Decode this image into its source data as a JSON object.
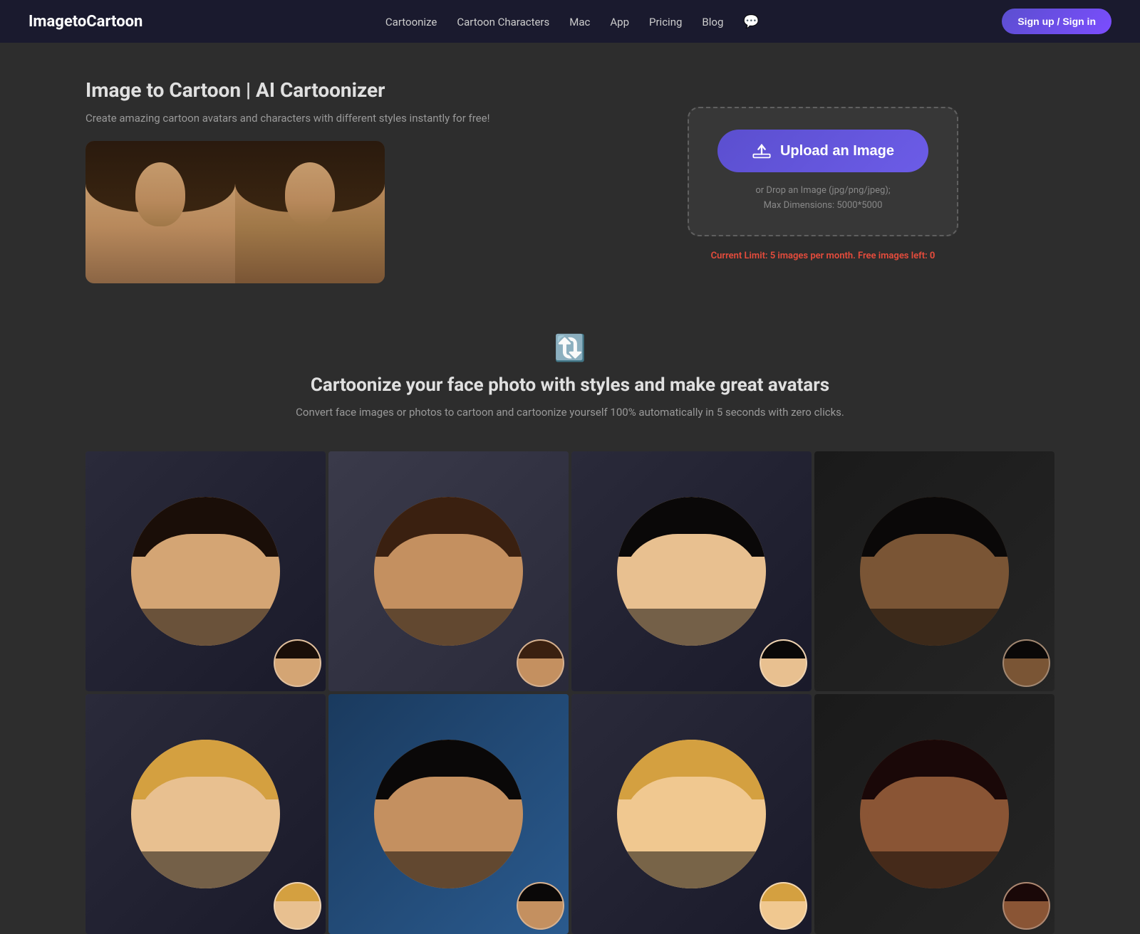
{
  "nav": {
    "logo": "ImagetoCartoon",
    "links": [
      {
        "label": "Cartoonize",
        "href": "#"
      },
      {
        "label": "Cartoon Characters",
        "href": "#"
      },
      {
        "label": "Mac",
        "href": "#"
      },
      {
        "label": "App",
        "href": "#"
      },
      {
        "label": "Pricing",
        "href": "#"
      },
      {
        "label": "Blog",
        "href": "#"
      }
    ],
    "chat_icon": "💬",
    "signup_label": "Sign up / Sign in"
  },
  "hero": {
    "title": "Image to Cartoon | AI Cartoonizer",
    "description": "Create amazing cartoon avatars and characters with different styles instantly for free!",
    "upload_btn_label": "Upload an Image",
    "upload_hint_line1": "or Drop an Image (jpg/png/jpeg);",
    "upload_hint_line2": "Max Dimensions: 5000*5000",
    "limit_text": "Current Limit: 5 images per month. Free images left:",
    "free_images_count": "0"
  },
  "section": {
    "heading": "Cartoonize your face photo with styles and make great avatars",
    "description": "Convert face images or photos to cartoon and cartoonize yourself 100% automatically in 5 seconds with zero clicks."
  },
  "gallery": {
    "rows": [
      [
        {
          "theme": "g1",
          "desc": "woman-cartoon-1"
        },
        {
          "theme": "g2",
          "desc": "man-cartoon-1"
        },
        {
          "theme": "g3",
          "desc": "woman-cartoon-2"
        },
        {
          "theme": "g4",
          "desc": "man-cartoon-2"
        }
      ],
      [
        {
          "theme": "g5",
          "desc": "woman-cartoon-3"
        },
        {
          "theme": "g6",
          "desc": "man-cartoon-3"
        },
        {
          "theme": "g7",
          "desc": "woman-cartoon-4"
        },
        {
          "theme": "g8",
          "desc": "man-cartoon-4"
        }
      ]
    ]
  }
}
